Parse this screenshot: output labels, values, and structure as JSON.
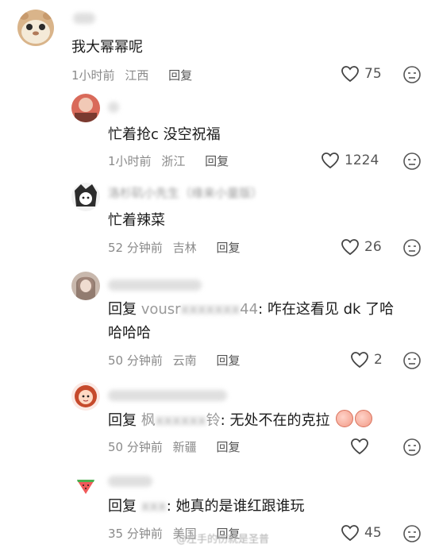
{
  "comments": [
    {
      "text": "我大幂幂呢",
      "time": "1小时前",
      "location": "江西",
      "reply_label": "回复",
      "likes": "75"
    },
    {
      "text": "忙着抢c 没空祝福",
      "time": "1小时前",
      "location": "浙江",
      "reply_label": "回复",
      "likes": "1224"
    },
    {
      "username": "洛杉矶小先生（缘来小童版）",
      "text": "忙着辣菜",
      "time": "52 分钟前",
      "location": "吉林",
      "reply_label": "回复",
      "likes": "26"
    },
    {
      "reply_prefix": "回复",
      "mention_visible_start": "vousr",
      "mention_visible_end": "44",
      "text_line1": ": 咋在这看见 dk 了哈",
      "text_line2": "哈哈哈",
      "time": "50 分钟前",
      "location": "云南",
      "reply_label": "回复",
      "likes": "2"
    },
    {
      "reply_prefix": "回复",
      "mention_visible_start": "枫",
      "mention_visible_end": "铃",
      "text": ": 无处不在的克拉",
      "time": "50 分钟前",
      "location": "新疆",
      "reply_label": "回复",
      "likes": ""
    },
    {
      "reply_prefix": "回复",
      "text": ": 她真的是谁红跟谁玩",
      "time": "35 分钟前",
      "location": "美国",
      "reply_label": "回复",
      "likes": "45"
    }
  ],
  "watermark": "@左手的伤就是圣普",
  "icons": {
    "like": "heart-outline-icon",
    "dislike": "dislike-face-icon"
  }
}
